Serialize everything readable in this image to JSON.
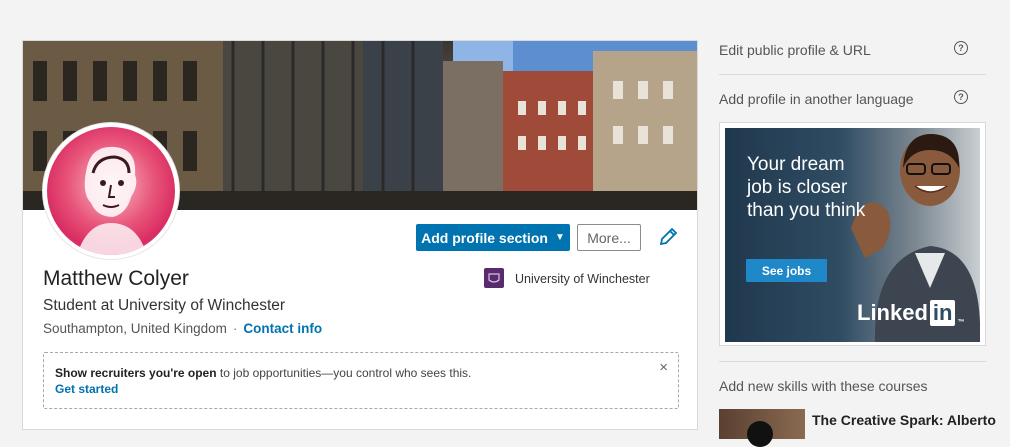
{
  "profile": {
    "name": "Matthew Colyer",
    "headline": "Student at University of Winchester",
    "location": "Southampton, United Kingdom",
    "separator": "·",
    "contact_label": "Contact info",
    "add_section_label": "Add profile section",
    "more_label": "More...",
    "school": "University of Winchester"
  },
  "open_to_work": {
    "bold_text": "Show recruiters you're open",
    "rest_text": " to job opportunities—you control who sees this.",
    "link": "Get started",
    "close": "×"
  },
  "sidebar": {
    "edit_public_profile": "Edit public profile & URL",
    "add_language": "Add profile in another language",
    "help_glyph": "?",
    "skills_title": "Add new skills with these courses",
    "course_title": "The Creative Spark: Alberto"
  },
  "ad": {
    "headline": "Your dream job is closer than you think",
    "button": "See jobs",
    "logo_text": "Linked",
    "logo_in": "in",
    "logo_tm": "™"
  },
  "colors": {
    "brand_blue": "#0073b1",
    "background": "#f3f3f3"
  },
  "icons": {
    "edit": "pencil-icon",
    "help": "help-circle-icon",
    "close": "close-icon",
    "caret": "caret-down-icon"
  }
}
